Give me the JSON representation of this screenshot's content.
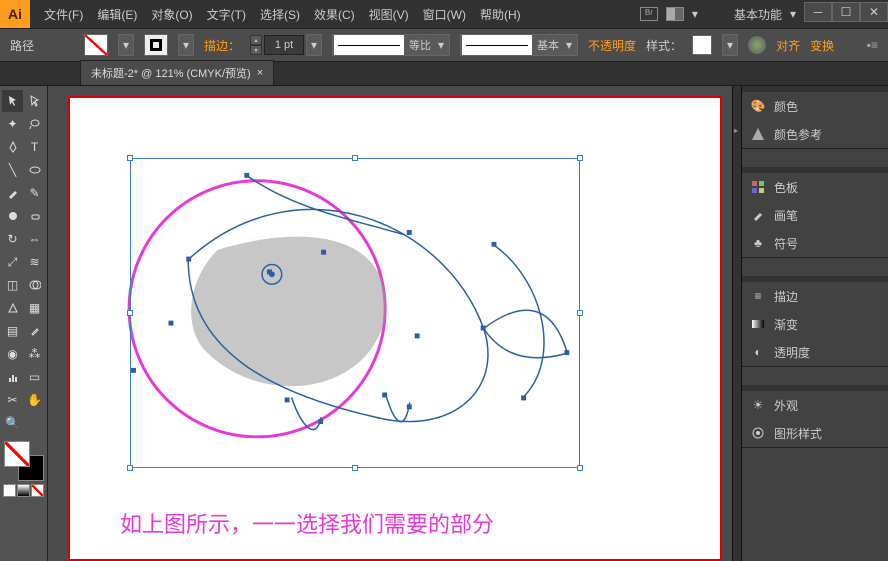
{
  "app": {
    "logo": "Ai"
  },
  "menu": {
    "file": "文件(F)",
    "edit": "编辑(E)",
    "object": "对象(O)",
    "type": "文字(T)",
    "select": "选择(S)",
    "effect": "效果(C)",
    "view": "视图(V)",
    "window": "窗口(W)",
    "help": "帮助(H)"
  },
  "titlebar": {
    "workspace": "基本功能"
  },
  "control": {
    "label_path": "路径",
    "stroke_label": "描边：",
    "stroke_value": "1 pt",
    "profile_label": "等比",
    "brush_label": "基本",
    "opacity_label": "不透明度",
    "style_label": "样式：",
    "align_label": "对齐",
    "transform_label": "变换"
  },
  "tab": {
    "title": "未标题-2* @ 121% (CMYK/预览)",
    "close": "×"
  },
  "canvas": {
    "caption": "如上图所示，一一选择我们需要的部分"
  },
  "panels": {
    "color": "颜色",
    "color_guide": "颜色参考",
    "swatches": "色板",
    "brushes": "画笔",
    "symbols": "符号",
    "stroke": "描边",
    "gradient": "渐变",
    "transparency": "透明度",
    "appearance": "外观",
    "graphic_styles": "图形样式"
  }
}
